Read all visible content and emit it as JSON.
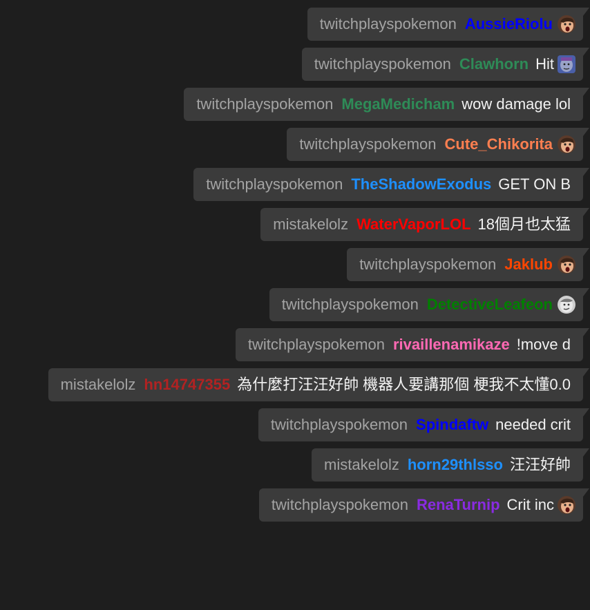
{
  "messages": [
    {
      "channel": "twitchplayspokemon",
      "user": "AussieRiolu",
      "color": "#0000ff",
      "text": "",
      "emote": "pogchamp-emote"
    },
    {
      "channel": "twitchplayspokemon",
      "user": "Clawhorn",
      "color": "#2e8b57",
      "text": "Hit",
      "emote": "kappa-pride-emote"
    },
    {
      "channel": "twitchplayspokemon",
      "user": "MegaMedicham",
      "color": "#2e8b57",
      "text": "wow damage lol",
      "emote": ""
    },
    {
      "channel": "twitchplayspokemon",
      "user": "Cute_Chikorita",
      "color": "#ff7f50",
      "text": "",
      "emote": "pogchamp-emote"
    },
    {
      "channel": "twitchplayspokemon",
      "user": "TheShadowExodus",
      "color": "#1e90ff",
      "text": "GET ON B",
      "emote": ""
    },
    {
      "channel": "mistakelolz",
      "user": "WaterVaporLOL",
      "color": "#ff0000",
      "text": "18個月也太猛",
      "emote": ""
    },
    {
      "channel": "twitchplayspokemon",
      "user": "Jaklub",
      "color": "#ff4500",
      "text": "",
      "emote": "pogchamp-emote"
    },
    {
      "channel": "twitchplayspokemon",
      "user": "DetectiveLeafeon",
      "color": "#008000",
      "text": "",
      "emote": "kappa-emote"
    },
    {
      "channel": "twitchplayspokemon",
      "user": "rivaillenamikaze",
      "color": "#ff69b4",
      "text": "!move d",
      "emote": ""
    },
    {
      "channel": "mistakelolz",
      "user": "hn14747355",
      "color": "#b22222",
      "text": "為什麼打汪汪好帥 機器人要講那個 梗我不太懂0.0",
      "emote": ""
    },
    {
      "channel": "twitchplayspokemon",
      "user": "Spindaftw",
      "color": "#0000ff",
      "text": "needed crit",
      "emote": ""
    },
    {
      "channel": "mistakelolz",
      "user": "horn29thlsso",
      "color": "#1e90ff",
      "text": "汪汪好帥",
      "emote": ""
    },
    {
      "channel": "twitchplayspokemon",
      "user": "RenaTurnip",
      "color": "#8a2be2",
      "text": "Crit inc",
      "emote": "pogchamp-emote"
    }
  ]
}
